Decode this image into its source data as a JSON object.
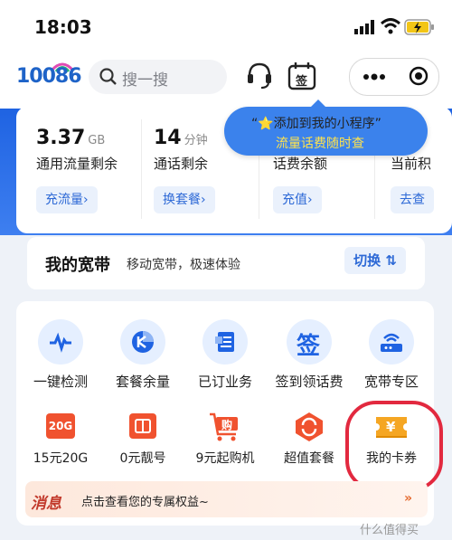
{
  "status_bar": {
    "time": "18:03"
  },
  "header": {
    "logo_text": "10086",
    "search_placeholder": "搜一搜",
    "icons": [
      "headset-icon",
      "calendar-sign-icon",
      "more-icon",
      "target-icon"
    ],
    "calendar_icon_text": "签"
  },
  "stats": [
    {
      "value": "3.37",
      "unit": "GB",
      "label": "通用流量剩余",
      "action": "充流量"
    },
    {
      "value": "14",
      "unit": "分钟",
      "label": "通话剩余",
      "action": "换套餐"
    },
    {
      "value": "",
      "unit": "",
      "label": "话费余额",
      "action": "充值"
    },
    {
      "value": "",
      "unit": "",
      "label": "当前积",
      "action": "去查"
    }
  ],
  "tooltip": {
    "line1": "“⭐添加到我的小程序”",
    "line2": "流量话费随时查"
  },
  "broadband": {
    "title": "我的宽带",
    "desc": "移动宽带，极速体验",
    "switch_label": "切换 ⇅"
  },
  "services_row1": [
    {
      "label": "一键检测",
      "icon": "pulse-icon"
    },
    {
      "label": "套餐余量",
      "icon": "package-icon"
    },
    {
      "label": "已订业务",
      "icon": "orders-icon"
    },
    {
      "label": "签到领话费",
      "icon": "checkin-icon",
      "icon_text": "签"
    },
    {
      "label": "宽带专区",
      "icon": "router-icon"
    }
  ],
  "services_row2": [
    {
      "label": "15元20G",
      "icon": "data-20g-icon",
      "icon_text": "20G"
    },
    {
      "label": "0元靓号",
      "icon": "sim-icon"
    },
    {
      "label": "9元起购机",
      "icon": "cart-icon",
      "icon_text": "购"
    },
    {
      "label": "超值套餐",
      "icon": "refresh-badge-icon"
    },
    {
      "label": "我的卡券",
      "icon": "coupon-icon",
      "icon_text": "¥"
    }
  ],
  "message": {
    "title": "消息",
    "text": "点击查看您的专属权益~",
    "arrow": "»"
  },
  "watermark": "什么值得买"
}
